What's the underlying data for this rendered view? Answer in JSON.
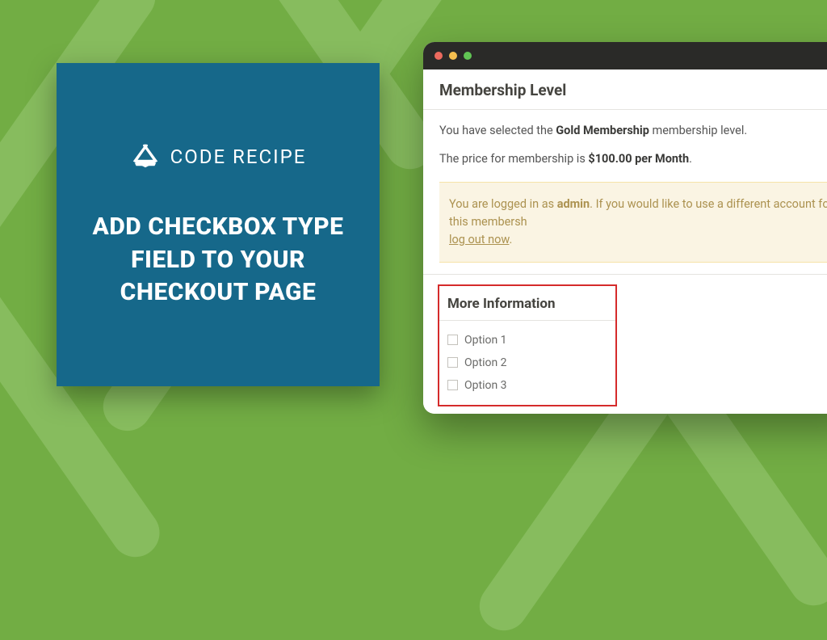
{
  "logo": {
    "text": "CODE RECIPE"
  },
  "heading": "ADD CHECKBOX TYPE FIELD TO YOUR CHECKOUT PAGE",
  "page": {
    "membership_title": "Membership Level",
    "selected_prefix": "You have selected the ",
    "selected_level": "Gold Membership",
    "selected_suffix": " membership level.",
    "price_prefix": "The price for membership is ",
    "price_value": "$100.00 per Month",
    "price_suffix": ".",
    "notice_prefix": "You are logged in as ",
    "notice_user": "admin",
    "notice_mid": ". If you would like to use a different account for this membersh",
    "notice_link": "log out now",
    "notice_end": ".",
    "more_title": "More Information",
    "options": [
      "Option 1",
      "Option 2",
      "Option 3"
    ]
  }
}
